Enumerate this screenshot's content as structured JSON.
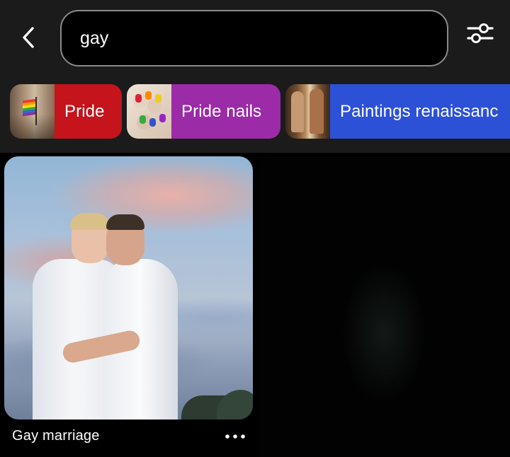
{
  "search": {
    "query": "gay"
  },
  "chips": [
    {
      "label": "Pride",
      "color": "#c5141b"
    },
    {
      "label": "Pride nails",
      "color": "#9b2ba7"
    },
    {
      "label": "Paintings renaissanc",
      "color": "#2d51d6"
    }
  ],
  "pins": [
    {
      "title": "Gay marriage"
    }
  ],
  "icons": {
    "back": "chevron-left-icon",
    "filter": "sliders-icon",
    "more": "ellipsis-icon"
  },
  "colors": {
    "background": "#1b1b1b",
    "search_box": "#000000",
    "search_border": "#8a8a8a",
    "text": "#ffffff"
  }
}
